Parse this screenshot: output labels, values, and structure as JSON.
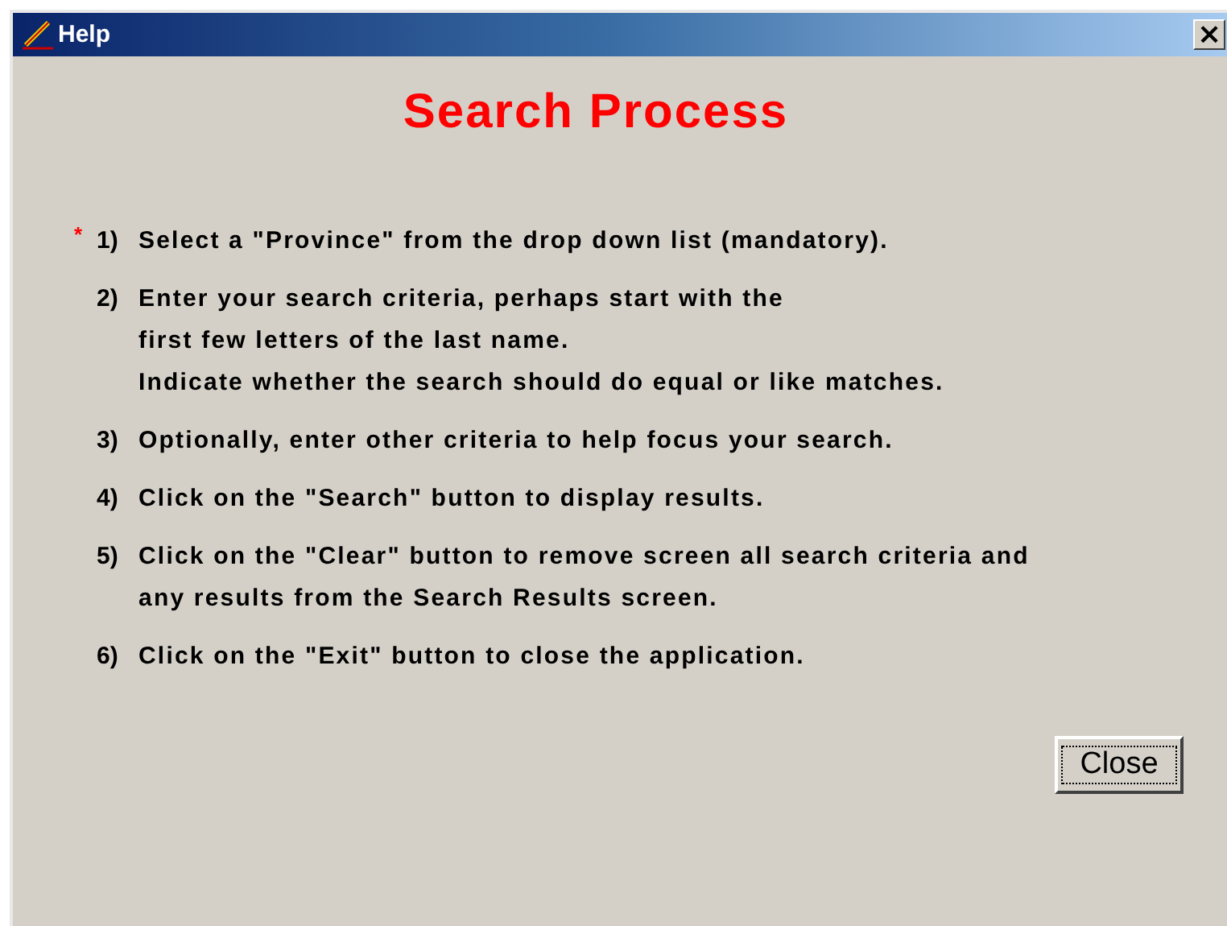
{
  "window": {
    "title": "Help"
  },
  "heading": "Search Process",
  "steps": [
    {
      "number": "1)",
      "required": true,
      "lines": [
        "Select a \"Province\" from the drop down list (mandatory)."
      ]
    },
    {
      "number": "2)",
      "required": false,
      "lines": [
        "Enter your search criteria, perhaps start with  the",
        "first few letters of the last name.",
        "Indicate whether the search should do equal or like matches."
      ]
    },
    {
      "number": "3)",
      "required": false,
      "lines": [
        "Optionally, enter other criteria to help focus your search."
      ]
    },
    {
      "number": "4)",
      "required": false,
      "lines": [
        "Click on the \"Search\" button to display results."
      ]
    },
    {
      "number": "5)",
      "required": false,
      "lines": [
        "Click on the \"Clear\" button to remove screen  all search criteria and",
        "any results from the Search Results screen."
      ]
    },
    {
      "number": "6)",
      "required": false,
      "lines": [
        "Click on the \"Exit\" button to close the application."
      ]
    }
  ],
  "required_mark": "*",
  "buttons": [
    {
      "label": "Close",
      "focused": true
    }
  ],
  "close_glyph": "×"
}
